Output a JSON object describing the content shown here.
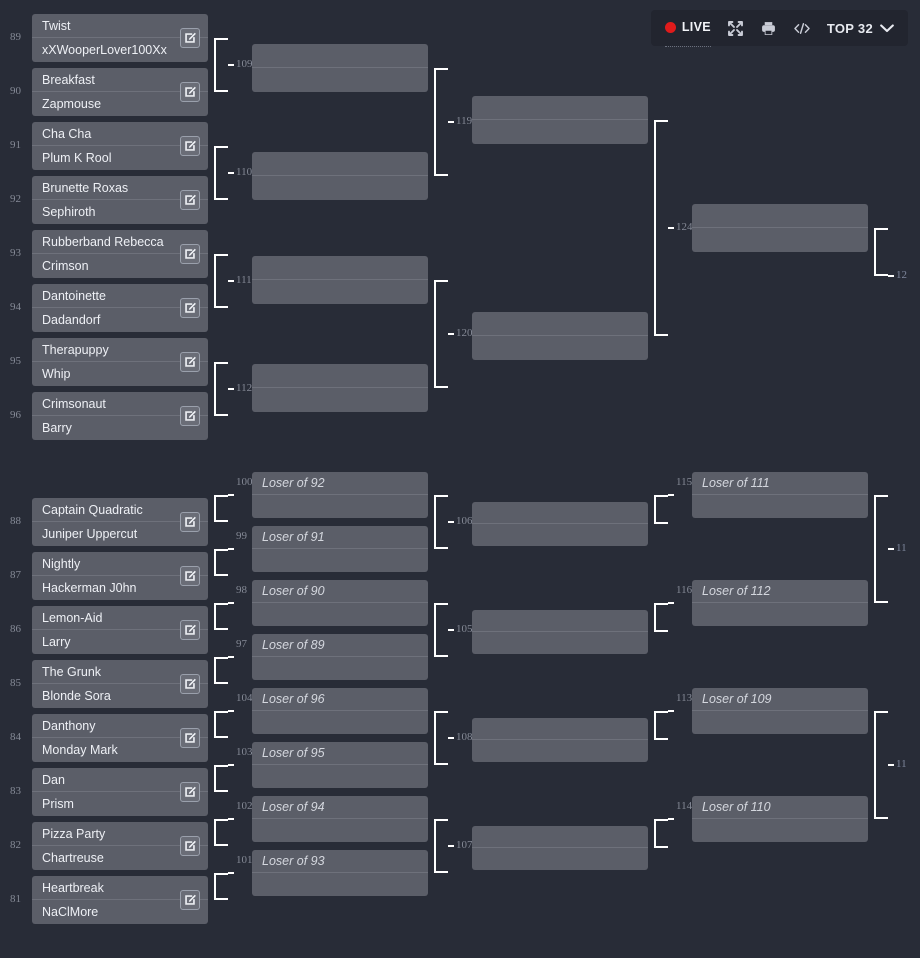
{
  "toolbar": {
    "live_label": "LIVE",
    "live_color": "#e01b1b",
    "fullscreen_icon": "expand-icon",
    "print_icon": "print-icon",
    "embed_icon": "code-icon",
    "phase_label": "TOP 32",
    "chevron_icon": "chevron-down-icon"
  },
  "theme": {
    "background": "#282c37",
    "match_box": "#5b5e68",
    "connector": "#ffffff",
    "match_number": "#858a96",
    "text": "#eef0f5"
  },
  "winners_bracket": {
    "round1": [
      {
        "number": "89",
        "top": "Twist",
        "bottom": "xXWooperLover100Xx",
        "edit_icon": "edit-pencil-icon"
      },
      {
        "number": "90",
        "top": "Breakfast",
        "bottom": "Zapmouse",
        "edit_icon": "edit-pencil-icon"
      },
      {
        "number": "91",
        "top": "Cha Cha",
        "bottom": "Plum K Rool",
        "edit_icon": "edit-pencil-icon"
      },
      {
        "number": "92",
        "top": "Brunette Roxas",
        "bottom": "Sephiroth",
        "edit_icon": "edit-pencil-icon"
      },
      {
        "number": "93",
        "top": "Rubberband Rebecca",
        "bottom": "Crimson",
        "edit_icon": "edit-pencil-icon"
      },
      {
        "number": "94",
        "top": "Dantoinette",
        "bottom": "Dadandorf",
        "edit_icon": "edit-pencil-icon"
      },
      {
        "number": "95",
        "top": "Therapuppy",
        "bottom": "Whip",
        "edit_icon": "edit-pencil-icon"
      },
      {
        "number": "96",
        "top": "Crimsonaut",
        "bottom": "Barry",
        "edit_icon": "edit-pencil-icon"
      }
    ],
    "round2": [
      {
        "number": "109",
        "top": "",
        "bottom": ""
      },
      {
        "number": "110",
        "top": "",
        "bottom": ""
      },
      {
        "number": "111",
        "top": "",
        "bottom": ""
      },
      {
        "number": "112",
        "top": "",
        "bottom": ""
      }
    ],
    "round3": [
      {
        "number": "119",
        "top": "",
        "bottom": ""
      },
      {
        "number": "120",
        "top": "",
        "bottom": ""
      }
    ],
    "round4": [
      {
        "number": "124",
        "top": "",
        "bottom": ""
      }
    ],
    "round5": [
      {
        "number": "12",
        "top": "",
        "bottom": ""
      }
    ]
  },
  "losers_bracket": {
    "round1": [
      {
        "number": "88",
        "top": "Captain Quadratic",
        "bottom": "Juniper Uppercut",
        "edit_icon": "edit-pencil-icon"
      },
      {
        "number": "87",
        "top": "Nightly",
        "bottom": "Hackerman J0hn",
        "edit_icon": "edit-pencil-icon"
      },
      {
        "number": "86",
        "top": "Lemon-Aid",
        "bottom": "Larry",
        "edit_icon": "edit-pencil-icon"
      },
      {
        "number": "85",
        "top": "The Grunk",
        "bottom": "Blonde Sora",
        "edit_icon": "edit-pencil-icon"
      },
      {
        "number": "84",
        "top": "Danthony",
        "bottom": "Monday Mark",
        "edit_icon": "edit-pencil-icon"
      },
      {
        "number": "83",
        "top": "Dan",
        "bottom": "Prism",
        "edit_icon": "edit-pencil-icon"
      },
      {
        "number": "82",
        "top": "Pizza Party",
        "bottom": "Chartreuse",
        "edit_icon": "edit-pencil-icon"
      },
      {
        "number": "81",
        "top": "Heartbreak",
        "bottom": "NaClMore",
        "edit_icon": "edit-pencil-icon"
      }
    ],
    "round2": [
      {
        "number": "100",
        "top": "Loser of 92",
        "bottom": ""
      },
      {
        "number": "99",
        "top": "Loser of 91",
        "bottom": ""
      },
      {
        "number": "98",
        "top": "Loser of 90",
        "bottom": ""
      },
      {
        "number": "97",
        "top": "Loser of 89",
        "bottom": ""
      },
      {
        "number": "104",
        "top": "Loser of 96",
        "bottom": ""
      },
      {
        "number": "103",
        "top": "Loser of 95",
        "bottom": ""
      },
      {
        "number": "102",
        "top": "Loser of 94",
        "bottom": ""
      },
      {
        "number": "101",
        "top": "Loser of 93",
        "bottom": ""
      }
    ],
    "round3": [
      {
        "number": "106",
        "top": "",
        "bottom": ""
      },
      {
        "number": "105",
        "top": "",
        "bottom": ""
      },
      {
        "number": "108",
        "top": "",
        "bottom": ""
      },
      {
        "number": "107",
        "top": "",
        "bottom": ""
      }
    ],
    "round4": [
      {
        "number": "115",
        "top": "Loser of 111",
        "bottom": ""
      },
      {
        "number": "116",
        "top": "Loser of 112",
        "bottom": ""
      },
      {
        "number": "113",
        "top": "Loser of 109",
        "bottom": ""
      },
      {
        "number": "114",
        "top": "Loser of 110",
        "bottom": ""
      }
    ],
    "round5": [
      {
        "number": "11",
        "top": "",
        "bottom": ""
      },
      {
        "number": "11",
        "top": "",
        "bottom": ""
      }
    ]
  }
}
